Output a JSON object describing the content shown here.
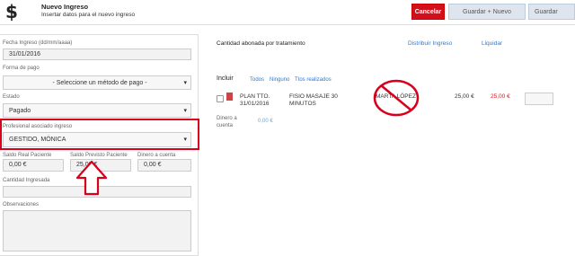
{
  "header": {
    "icon": "dollar-icon",
    "title": "Nuevo Ingreso",
    "subtitle": "Insertar datos para el nuevo ingreso",
    "cancel_label": "Cancelar",
    "save_new_label": "Guardar + Nuevo",
    "save_label": "Guardar",
    "dropdown_icon": "chevron-down-icon"
  },
  "form": {
    "fecha_label": "Fecha Ingreso (dd/mm/aaaa)",
    "fecha_value": "31/01/2016",
    "forma_label": "Forma de pago",
    "forma_value": "- Seleccione un método de pago -",
    "estado_label": "Estado",
    "estado_value": "Pagado",
    "profesional_label": "Profesional asociado ingreso",
    "profesional_value": "GESTIDO, MÓNICA",
    "saldo_real_label": "Saldo Real Paciente",
    "saldo_real_value": "0,00 €",
    "saldo_prev_label": "Saldo Previsto Paciente",
    "saldo_prev_value": "25,00 €",
    "dinero_label": "Dinero a cuenta",
    "dinero_value": "0,00 €",
    "cantidad_label": "Cantidad Ingresada",
    "observ_label": "Observaciones"
  },
  "right": {
    "title": "Cantidad abonada por tratamiento",
    "distribuir": "Distribuir Ingreso",
    "liquidar": "Liquidar",
    "incluir": "Incluir",
    "todos": "Todos",
    "ninguno": "Ninguno",
    "ttos": "Ttos realizados",
    "row": {
      "plan": "PLAN TTO.",
      "date": "31/01/2016",
      "desc1": "FISIO MASAJE 30",
      "desc2": "MINUTOS",
      "prof": "MARTA LÓPEZ",
      "price": "25,00 €",
      "pending": "25,00 €"
    },
    "dinero_label1": "Dinero a",
    "dinero_label2": "cuenta",
    "dinero_value": "0,00 €"
  },
  "colors": {
    "accent": "#d9001b",
    "link": "#2a7ad6"
  }
}
